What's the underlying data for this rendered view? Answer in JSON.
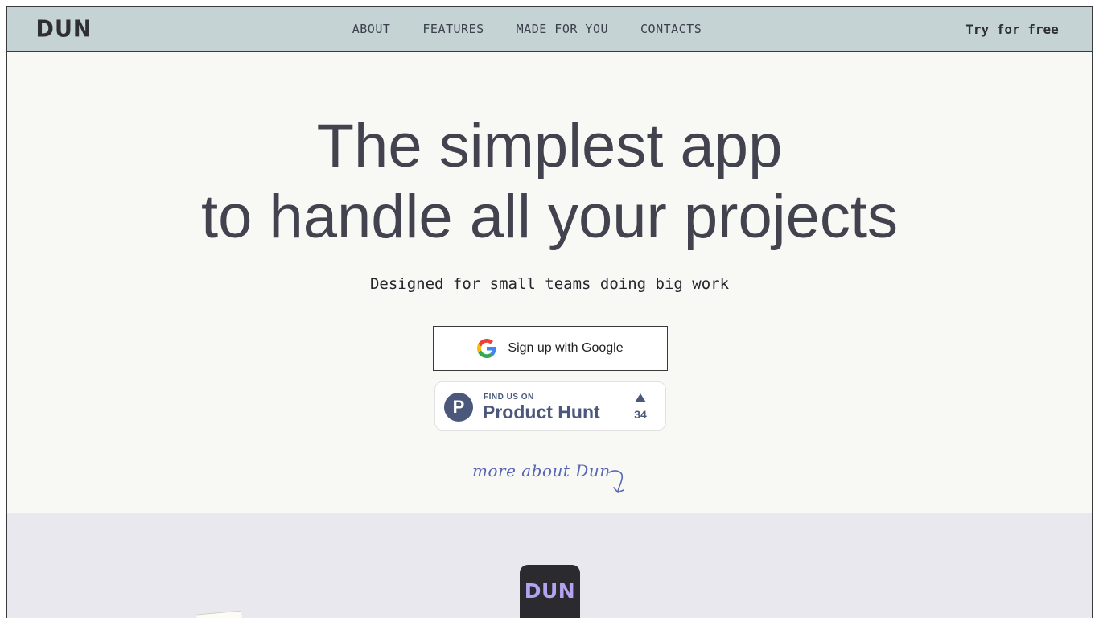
{
  "header": {
    "logo": "DUN",
    "nav": [
      {
        "label": "ABOUT"
      },
      {
        "label": "FEATURES"
      },
      {
        "label": "MADE FOR YOU"
      },
      {
        "label": "CONTACTS"
      }
    ],
    "cta": "Try for free"
  },
  "hero": {
    "headline_line1": "The simplest app",
    "headline_line2": "to handle all your projects",
    "subtitle": "Designed for small teams doing big work",
    "google_button": "Sign up with Google",
    "product_hunt": {
      "caption": "FIND US ON",
      "name": "Product Hunt",
      "logo_letter": "P",
      "upvotes": "34"
    },
    "more_link": "more about Dun"
  },
  "lower": {
    "app_icon_text": "DUN"
  },
  "colors": {
    "header_bg": "#c6d3d4",
    "hero_bg": "#f8f8f5",
    "lower_bg": "#e9e8ee",
    "headline": "#43434f",
    "product_hunt": "#4b587c",
    "more_link": "#5867b4",
    "app_icon_bg": "#2b2b2f",
    "app_icon_text": "#b3a3f0"
  },
  "icons": {
    "google": "google-g-icon",
    "product_hunt": "product-hunt-logo-icon",
    "upvote": "triangle-up-icon",
    "more_arrow": "curved-arrow-down-icon"
  }
}
